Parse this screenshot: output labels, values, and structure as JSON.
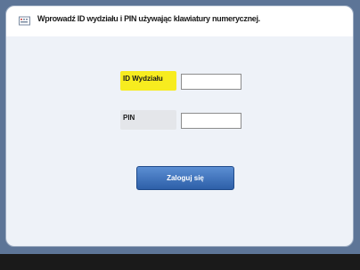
{
  "dialog": {
    "message": "Wprowadź ID wydziału i PIN używając klawiatury numerycznej.",
    "message_icon": "keyboard-info-icon"
  },
  "form": {
    "department_id_label": "ID Wydziału",
    "department_id_value": "",
    "pin_label": "PIN",
    "pin_value": ""
  },
  "actions": {
    "login_label": "Zaloguj się"
  },
  "colors": {
    "active_label": "#f7ec1f",
    "button": "#2d5fa8"
  }
}
